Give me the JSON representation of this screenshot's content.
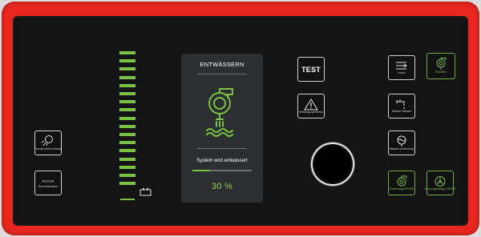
{
  "left_keys": {
    "lighting_label": "Garraumbeleuchtung",
    "service_label": "Servicefunktion"
  },
  "level_indicator": {
    "fill_fraction": 1.0,
    "segments": 17,
    "battery_icon": "battery-icon"
  },
  "screen": {
    "title": "ENTWÄSSERN",
    "status": "System wird entwässert",
    "progress_percent": 30,
    "progress_text": "30 %",
    "icon": "pump-drain-icon"
  },
  "center_keys": {
    "test_label": "TEST",
    "warning_label": "Meldung quittieren"
  },
  "right_keys": {
    "entkalken_label": "Lesen",
    "schalten_label": "Schalten",
    "wasser_label": "Wärme Wasser",
    "wasser_entleeren_label": "Wasser-entleerung",
    "pump_label": "Entleerung ENTER",
    "system_label": "Heizungsanlage ENTER"
  },
  "colors": {
    "frame": "#e8261f",
    "panel": "#141414",
    "accent": "#7ac142",
    "screen": "#2b2f31"
  }
}
